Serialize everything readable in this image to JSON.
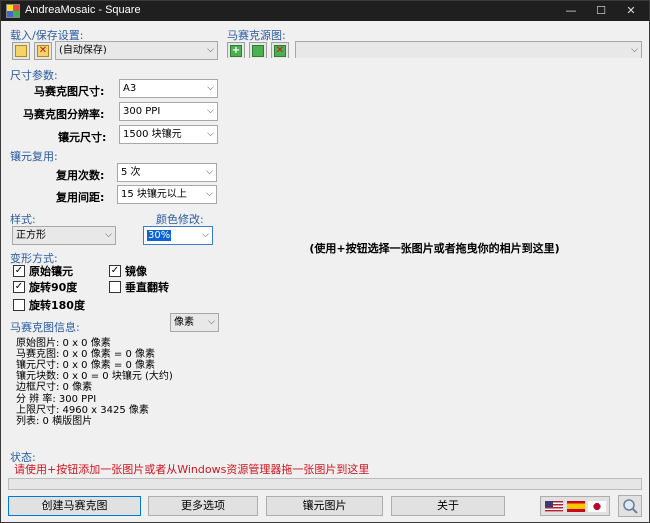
{
  "window": {
    "title": "AndreaMosaic - Square",
    "controls": {
      "minimize": "—",
      "maximize": "☐",
      "close": "✕"
    }
  },
  "load_save": {
    "heading": "载入/保存设置:",
    "preset_value": "(自动保存)",
    "icons": [
      "load-icon",
      "save-icon"
    ]
  },
  "mosaic_source": {
    "heading": "马赛克源图:",
    "combo_value": "",
    "icons": [
      "add-image-icon",
      "edit-image-icon",
      "remove-image-icon"
    ]
  },
  "size_params": {
    "heading": "尺寸参数:",
    "mosaic_size_label": "马赛克图尺寸:",
    "mosaic_size_value": "A3",
    "resolution_label": "马赛克图分辨率:",
    "resolution_value": "300 PPI",
    "tile_size_label": "镶元尺寸:",
    "tile_size_value": "1500 块镶元"
  },
  "tile_reuse": {
    "heading": "镶元复用:",
    "reuse_count_label": "复用次数:",
    "reuse_count_value": "5 次",
    "reuse_distance_label": "复用间距:",
    "reuse_distance_value": "15  块镶元以上"
  },
  "style": {
    "heading": "样式:",
    "value": "正方形"
  },
  "color_change": {
    "heading": "颜色修改:",
    "value": "30%"
  },
  "transform": {
    "heading": "变形方式:",
    "options": [
      {
        "label": "原始镶元",
        "checked": true
      },
      {
        "label": "镜像",
        "checked": true
      },
      {
        "label": "旋转90度",
        "checked": true
      },
      {
        "label": "垂直翻转",
        "checked": false
      },
      {
        "label": "旋转180度",
        "checked": false
      }
    ]
  },
  "mosaic_info": {
    "heading": "马赛克图信息:",
    "unit_value": "像素",
    "lines": [
      "原始图片: 0 x 0 像素",
      "马赛克图: 0 x 0 像素 = 0 像素",
      "镶元尺寸: 0 x 0 像素 = 0 像素",
      "镶元块数: 0 x 0 = 0 块镶元 (大约)",
      "边框尺寸: 0 像素",
      "分 辨 率: 300 PPI",
      "上限尺寸: 4960 x 3425 像素",
      "列表: 0 横版图片"
    ]
  },
  "preview": {
    "message": "(使用+按钮选择一张图片或者拖曳你的相片到这里)"
  },
  "status": {
    "heading": "状态:",
    "message": "请使用+按钮添加一张图片或者从Windows资源管理器拖一张图片到这里",
    "progress": 0
  },
  "buttons": {
    "create": "创建马赛克图",
    "more_options": "更多选项",
    "tile_images": "镶元图片",
    "about": "关于"
  },
  "colors": {
    "accent_blue": "#2a5aa0",
    "status_red": "#d0151f"
  }
}
